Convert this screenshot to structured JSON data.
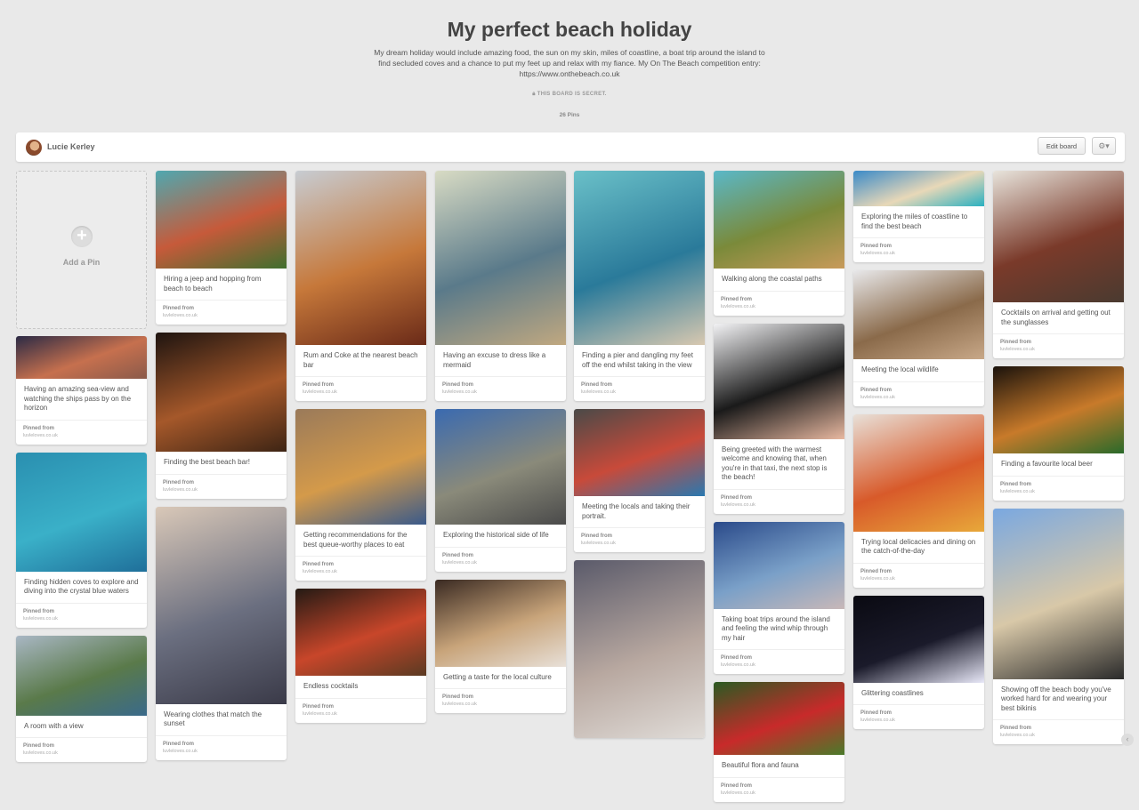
{
  "board": {
    "title": "My perfect beach holiday",
    "description": "My dream holiday would include amazing food, the sun on my skin, miles of coastline, a boat trip around the island to find secluded coves and a chance to put my feet up and relax with my fiance. My On The Beach competition entry: https://www.onthebeach.co.uk",
    "secret_label": "THIS BOARD IS SECRET.",
    "pin_count": "26 Pins"
  },
  "toolbar": {
    "user_name": "Lucie Kerley",
    "edit_label": "Edit board",
    "gear_icon": "gear-icon"
  },
  "add_pin_label": "Add a Pin",
  "pinned_from_label": "Pinned from",
  "source_site": "luvleloves.co.uk",
  "columns": [
    [
      {
        "caption": "Having an amazing sea-view and watching the ships pass by on the horizon",
        "colors": [
          "#2b2a45",
          "#c6704e",
          "#8a5a4a"
        ]
      },
      {
        "caption": "Finding hidden coves to explore and diving into the crystal blue waters",
        "colors": [
          "#2a8fb0",
          "#3ab0c8",
          "#1f6f9a"
        ]
      },
      {
        "caption": "A room with a view",
        "colors": [
          "#a9b7c4",
          "#5a7a4a",
          "#3a6a8a"
        ]
      }
    ],
    [
      {
        "caption": "Hiring a jeep and hopping from beach to beach",
        "colors": [
          "#4fa8b0",
          "#c65a3a",
          "#3f6f2e"
        ]
      },
      {
        "caption": "Finding the best beach bar!",
        "colors": [
          "#1e1410",
          "#a5582a",
          "#3d2414"
        ]
      },
      {
        "caption": "Wearing clothes that match the sunset",
        "colors": [
          "#d9c8b8",
          "#6b6f80",
          "#3a3a48"
        ]
      }
    ],
    [
      {
        "caption": "Rum and Coke at the nearest beach bar",
        "colors": [
          "#c7ccd2",
          "#c6783a",
          "#6a2a18"
        ]
      },
      {
        "caption": "Getting recommendations for the best queue-worthy places to eat",
        "colors": [
          "#9a7a5a",
          "#d49a4a",
          "#3a5a8a"
        ]
      },
      {
        "caption": "Endless cocktails",
        "colors": [
          "#241a14",
          "#c8462a",
          "#5a3a22"
        ]
      }
    ],
    [
      {
        "caption": "Having an excuse to dress like a mermaid",
        "colors": [
          "#d8dbc4",
          "#5a7a8a",
          "#c0a880"
        ]
      },
      {
        "caption": "Exploring the historical side of life",
        "colors": [
          "#3a6ab0",
          "#8a8a7a",
          "#4a4a4a"
        ]
      },
      {
        "caption": "Getting a taste for the local culture",
        "colors": [
          "#3a2a22",
          "#c8a47a",
          "#e8e0d8"
        ]
      }
    ],
    [
      {
        "caption": "Finding a pier and dangling my feet off the end whilst taking in the view",
        "colors": [
          "#6ac0c8",
          "#2a7a9a",
          "#d8c8b0"
        ]
      },
      {
        "caption": "Meeting the locals and taking their portrait.",
        "colors": [
          "#4a4a48",
          "#c84a3a",
          "#2a78b0"
        ]
      },
      {
        "caption": "",
        "colors": [
          "#5a5a6a",
          "#b8a8a0",
          "#e0dcd8"
        ]
      }
    ],
    [
      {
        "caption": "Walking along the coastal paths",
        "colors": [
          "#5ab8c8",
          "#7a8a3a",
          "#c89a5a"
        ]
      },
      {
        "caption": "Being greeted with the warmest welcome and knowing that, when you're in that taxi, the next stop is the beach!",
        "colors": [
          "#f2f2f4",
          "#1a1a1a",
          "#e8b8a0"
        ]
      },
      {
        "caption": "Taking boat trips around the island and feeling the wind whip through my hair",
        "colors": [
          "#2a4a8a",
          "#7aa0c8",
          "#c8b8b8"
        ]
      },
      {
        "caption": "Beautiful flora and fauna",
        "colors": [
          "#2a5a22",
          "#c82a2a",
          "#4a7a2a"
        ]
      }
    ],
    [
      {
        "caption": "Exploring the miles of coastline to find the best beach",
        "colors": [
          "#3a8ac8",
          "#e8d8b8",
          "#2ab0c0"
        ]
      },
      {
        "caption": "Meeting the local wildlife",
        "colors": [
          "#e8e8ea",
          "#8a6a4a",
          "#c8a888"
        ]
      },
      {
        "caption": "Trying local delicacies and dining on the catch-of-the-day",
        "colors": [
          "#e8e0d8",
          "#d85a2a",
          "#e8a83a"
        ]
      },
      {
        "caption": "Glittering coastlines",
        "colors": [
          "#0a0a12",
          "#1a1a2a",
          "#e8e8f8"
        ]
      }
    ],
    [
      {
        "caption": "Cocktails on arrival and getting out the sunglasses",
        "colors": [
          "#e8e4dc",
          "#7a3a2a",
          "#4a3a30"
        ]
      },
      {
        "caption": "Finding a favourite local beer",
        "colors": [
          "#1a120c",
          "#c87a2a",
          "#2a6a2a"
        ]
      },
      {
        "caption": "Showing off the beach body you've worked hard for and wearing your best bikinis",
        "colors": [
          "#7aa8e0",
          "#d8c8a8",
          "#2a2a2a"
        ]
      }
    ]
  ]
}
